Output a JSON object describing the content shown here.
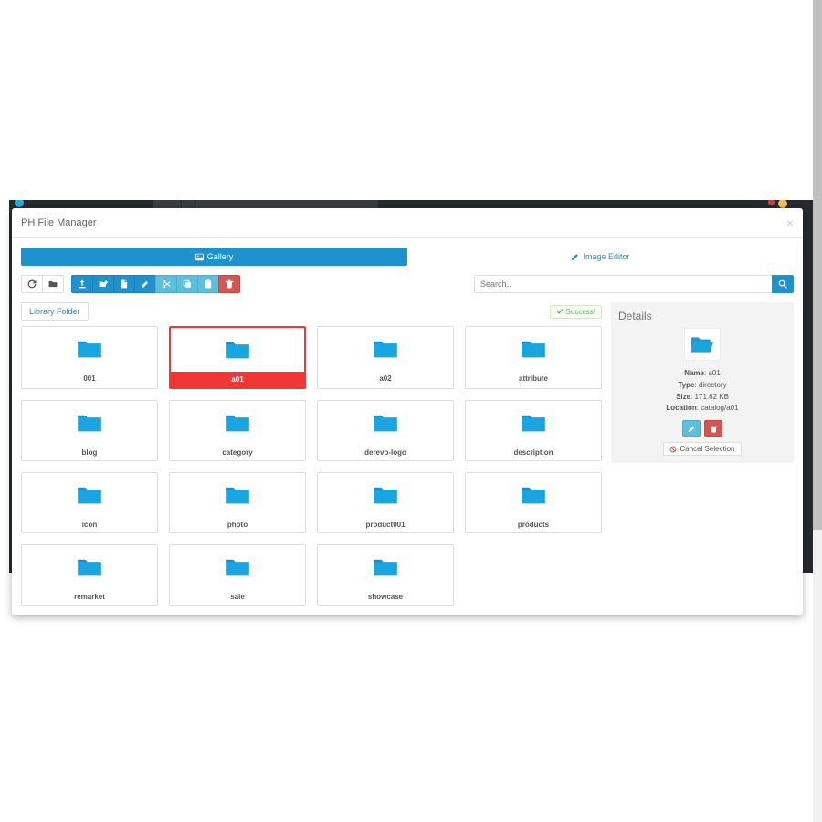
{
  "modal": {
    "title": "PH File Manager",
    "tabs": {
      "gallery": "Gallery",
      "editor": "Image Editor"
    },
    "search_placeholder": "Search..",
    "breadcrumb": "Library Folder",
    "success": "Success!"
  },
  "folders": [
    {
      "name": "001",
      "selected": false
    },
    {
      "name": "a01",
      "selected": true
    },
    {
      "name": "a02",
      "selected": false
    },
    {
      "name": "attribute",
      "selected": false
    },
    {
      "name": "blog",
      "selected": false
    },
    {
      "name": "category",
      "selected": false
    },
    {
      "name": "derevo-logo",
      "selected": false
    },
    {
      "name": "description",
      "selected": false
    },
    {
      "name": "icon",
      "selected": false
    },
    {
      "name": "photo",
      "selected": false
    },
    {
      "name": "product001",
      "selected": false
    },
    {
      "name": "products",
      "selected": false
    },
    {
      "name": "remarket",
      "selected": false
    },
    {
      "name": "sale",
      "selected": false
    },
    {
      "name": "showcase",
      "selected": false
    }
  ],
  "details": {
    "title": "Details",
    "name_label": "Name",
    "name_value": "a01",
    "type_label": "Type",
    "type_value": "directory",
    "size_label": "Size",
    "size_value": "171.62 KB",
    "location_label": "Location",
    "location_value": "catalog/a01",
    "cancel": "Cancel Selection"
  }
}
